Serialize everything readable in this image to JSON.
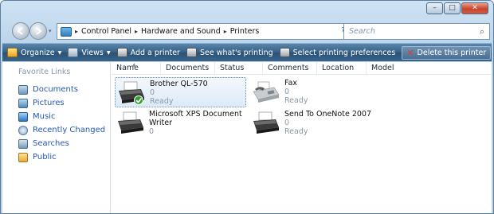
{
  "window": {
    "caption": {
      "minimize": "–",
      "maximize": "□",
      "close": "✕"
    }
  },
  "nav": {
    "back_icon": "back-arrow-icon",
    "forward_icon": "forward-arrow-icon",
    "recent_dropdown": "▾",
    "breadcrumb": [
      "Control Panel",
      "Hardware and Sound",
      "Printers"
    ],
    "separator": "▸",
    "address_dropdown": "▾",
    "refresh": "↻",
    "search_placeholder": "Search",
    "search_icon": "⌕"
  },
  "toolbar": {
    "organize": "Organize",
    "views": "Views",
    "add_printer": "Add a printer",
    "see_printing": "See what's printing",
    "select_prefs": "Select printing preferences",
    "delete_printer": "Delete this printer",
    "more": "»",
    "help": "?",
    "dropdown_arrow": "▾"
  },
  "sidebar": {
    "title": "Favorite Links",
    "items": [
      {
        "label": "Documents"
      },
      {
        "label": "Pictures"
      },
      {
        "label": "Music"
      },
      {
        "label": "Recently Changed"
      },
      {
        "label": "Searches"
      },
      {
        "label": "Public"
      }
    ]
  },
  "list": {
    "sort_indicator": "▲",
    "columns": [
      "Name",
      "Documents",
      "Status",
      "Comments",
      "Location",
      "Model"
    ],
    "printers": [
      {
        "name": "Brother QL-570",
        "documents": "0",
        "status": "Ready",
        "default": true,
        "selected": true,
        "type": "printer"
      },
      {
        "name": "Fax",
        "documents": "0",
        "status": "Ready",
        "default": false,
        "selected": false,
        "type": "fax"
      },
      {
        "name_line1": "Microsoft XPS Document",
        "name_line2": "Writer",
        "documents": "0",
        "status": "",
        "default": false,
        "selected": false,
        "type": "printer"
      },
      {
        "name": "Send To OneNote 2007",
        "documents": "0",
        "status": "Ready",
        "default": false,
        "selected": false,
        "type": "printer"
      }
    ]
  },
  "colors": {
    "toolbar_bg": "#355f84",
    "link_blue": "#2358b5",
    "default_check": "#2fa12f",
    "close_red": "#c8452c"
  }
}
